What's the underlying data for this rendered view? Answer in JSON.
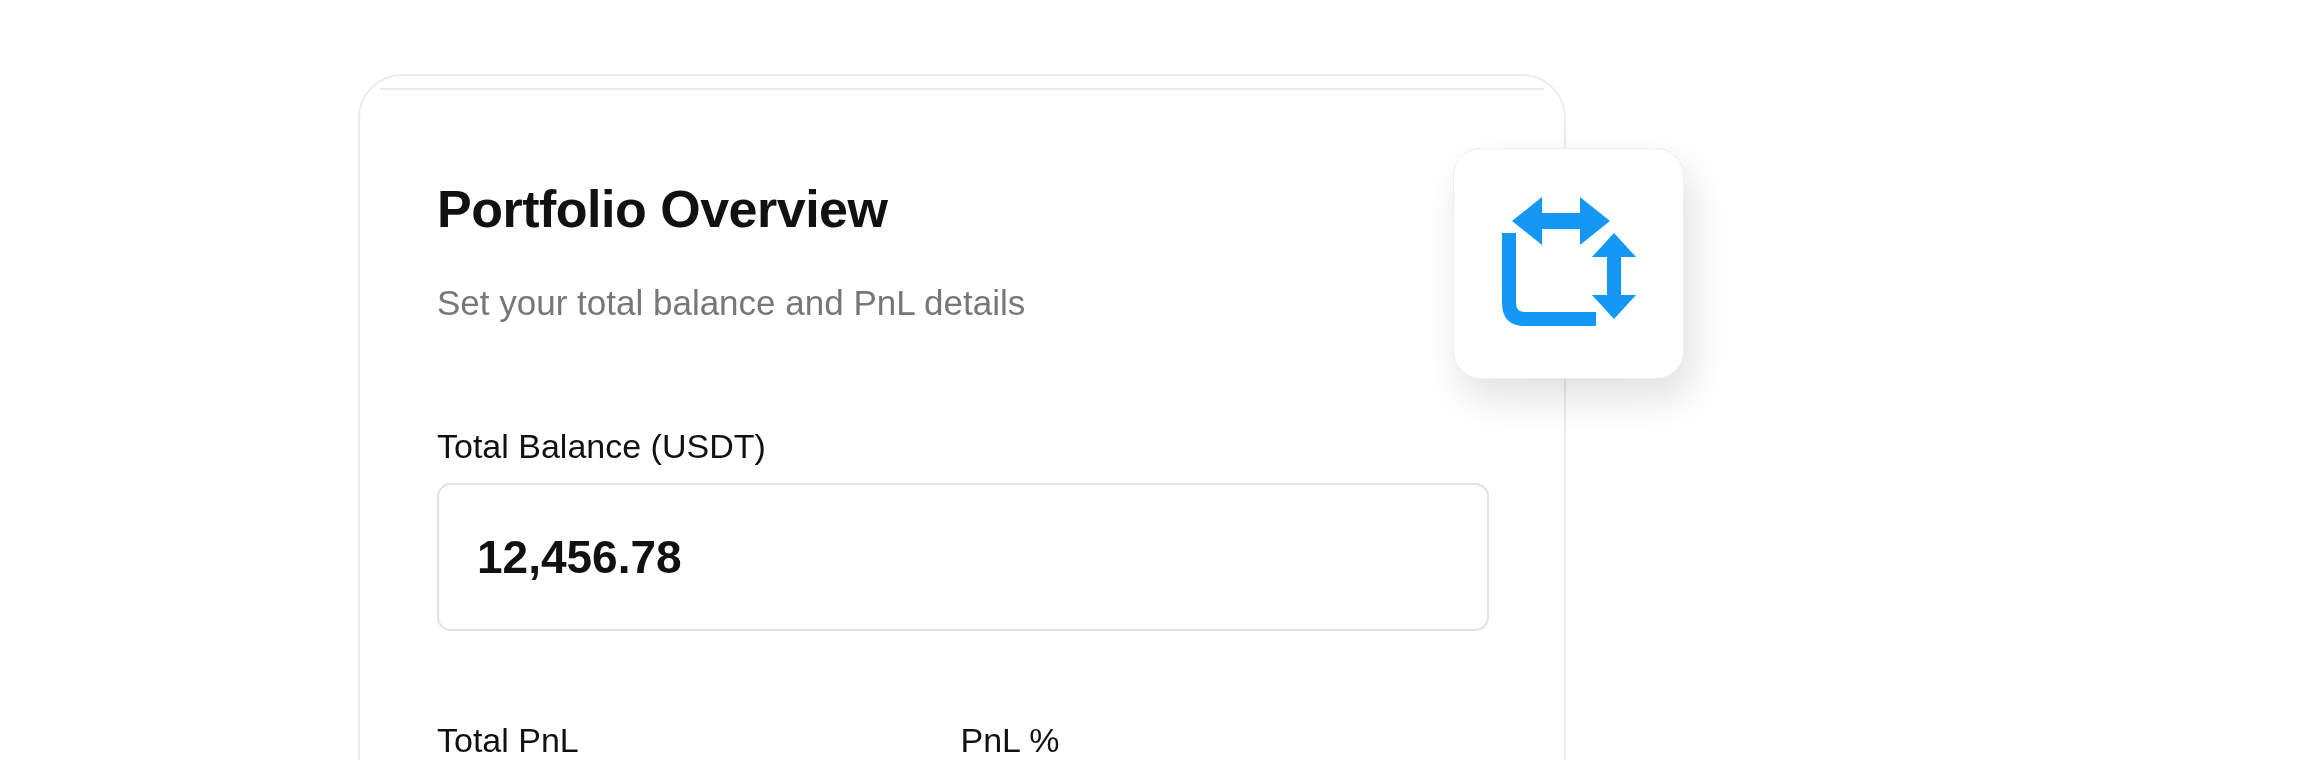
{
  "card": {
    "title": "Portfolio Overview",
    "subtitle": "Set your total balance and PnL details"
  },
  "balance": {
    "label": "Total Balance (USDT)",
    "value": "12,456.78"
  },
  "fields": [
    {
      "label": "Total PnL"
    },
    {
      "label": "PnL %"
    }
  ]
}
